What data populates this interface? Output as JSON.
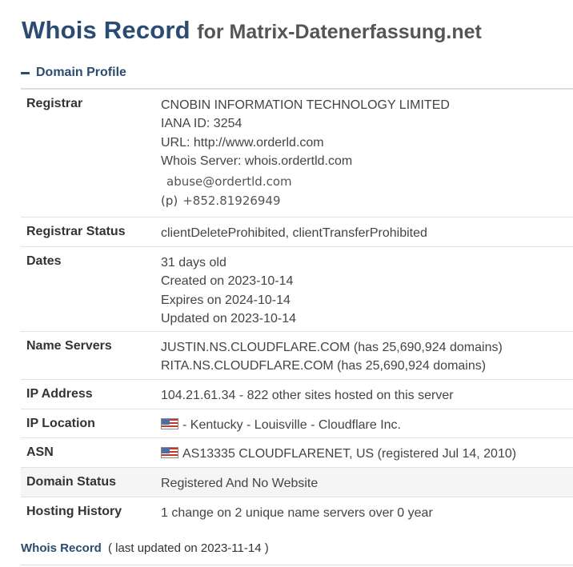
{
  "header": {
    "title": "Whois Record",
    "subtitle": "for Matrix-Datenerfassung.net"
  },
  "section": {
    "label": "Domain Profile"
  },
  "registrar": {
    "label": "Registrar",
    "name": "CNOBIN INFORMATION TECHNOLOGY LIMITED",
    "iana": "IANA ID: 3254",
    "url": "URL: http://www.orderld.com",
    "whois_server": "Whois Server: whois.ordertld.com",
    "email": "abuse@ordertld.com",
    "phone_prefix": "(p)",
    "phone": "+852.81926949"
  },
  "registrar_status": {
    "label": "Registrar Status",
    "value": "clientDeleteProhibited, clientTransferProhibited"
  },
  "dates": {
    "label": "Dates",
    "age": "31 days old",
    "created": "Created on 2023-10-14",
    "expires": "Expires on 2024-10-14",
    "updated": "Updated on 2023-10-14"
  },
  "name_servers": {
    "label": "Name Servers",
    "ns1": "JUSTIN.NS.CLOUDFLARE.COM (has 25,690,924 domains)",
    "ns2": "RITA.NS.CLOUDFLARE.COM (has 25,690,924 domains)"
  },
  "ip_address": {
    "label": "IP Address",
    "value": "104.21.61.34 - 822 other sites hosted on this server"
  },
  "ip_location": {
    "label": "IP Location",
    "value": "- Kentucky - Louisville - Cloudflare Inc.",
    "flag": "us-flag-icon"
  },
  "asn": {
    "label": "ASN",
    "value": "AS13335 CLOUDFLARENET, US (registered Jul 14, 2010)",
    "flag": "us-flag-icon"
  },
  "domain_status": {
    "label": "Domain Status",
    "value": "Registered And No Website"
  },
  "hosting_history": {
    "label": "Hosting History",
    "value": "1 change on 2 unique name servers over 0 year"
  },
  "footer": {
    "link": "Whois Record",
    "note": "( last updated on 2023-11-14 )"
  },
  "colors": {
    "heading": "#2a4c74",
    "shaded_row": "#f5f5f5"
  }
}
